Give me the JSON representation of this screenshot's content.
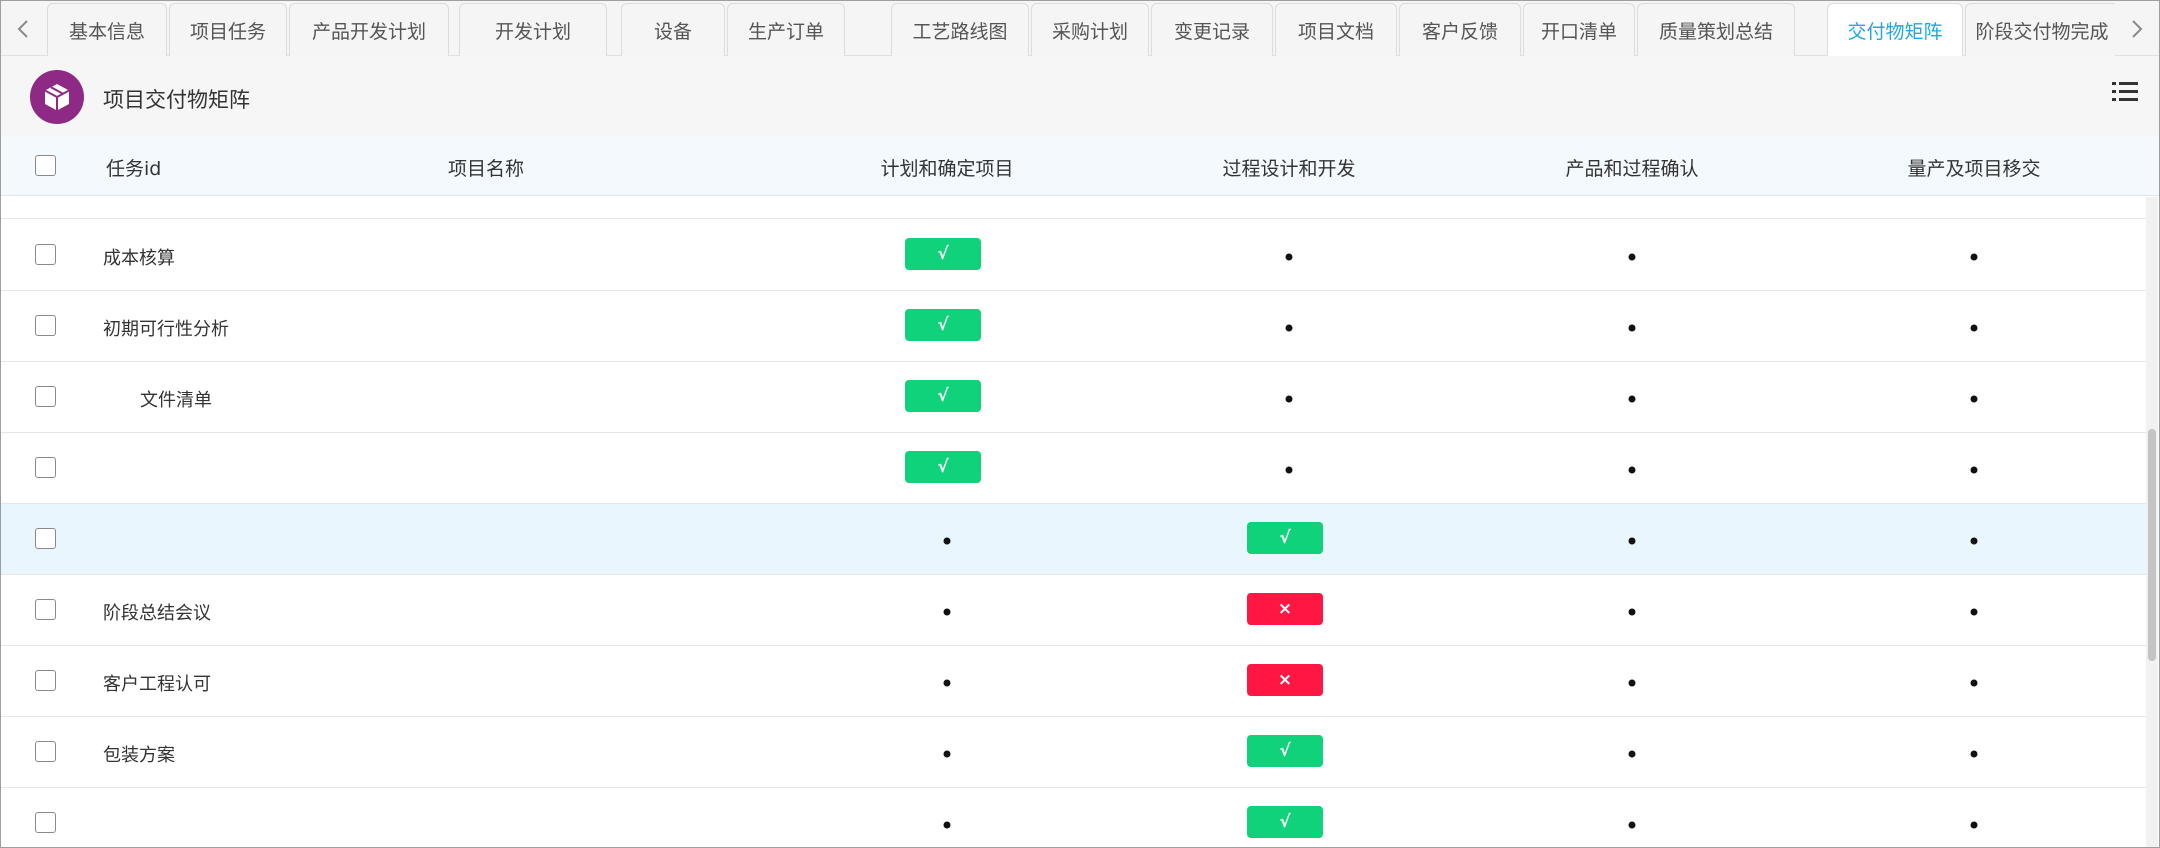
{
  "tabs": [
    {
      "label": "基本信息",
      "active": false
    },
    {
      "label": "项目任务",
      "active": false
    },
    {
      "label": "产品开发计划",
      "active": false
    },
    {
      "label": "开发计划",
      "active": false
    },
    {
      "label": "设备",
      "active": false
    },
    {
      "label": "生产订单",
      "active": false
    },
    {
      "label": "工艺路线图",
      "active": false
    },
    {
      "label": "采购计划",
      "active": false
    },
    {
      "label": "变更记录",
      "active": false
    },
    {
      "label": "项目文档",
      "active": false
    },
    {
      "label": "客户反馈",
      "active": false
    },
    {
      "label": "开口清单",
      "active": false
    },
    {
      "label": "质量策划总结",
      "active": false
    },
    {
      "label": "交付物矩阵",
      "active": true
    },
    {
      "label": "阶段交付物完成",
      "active": false
    }
  ],
  "header": {
    "title": "项目交付物矩阵"
  },
  "table": {
    "columns": {
      "task_id": "任务id",
      "project_name": "项目名称",
      "phase1": "计划和确定项目",
      "phase2": "过程设计和开发",
      "phase3": "产品和过程确认",
      "phase4": "量产及项目移交"
    },
    "rows": [
      {
        "name": "成本核算",
        "indent": false,
        "highlight": false,
        "cells": [
          "ok",
          "dot",
          "dot",
          "dot"
        ]
      },
      {
        "name": "初期可行性分析",
        "indent": false,
        "highlight": false,
        "cells": [
          "ok",
          "dot",
          "dot",
          "dot"
        ]
      },
      {
        "name": "文件清单",
        "indent": true,
        "highlight": false,
        "cells": [
          "ok",
          "dot",
          "dot",
          "dot"
        ]
      },
      {
        "name": "",
        "indent": false,
        "highlight": false,
        "cells": [
          "ok",
          "dot",
          "dot",
          "dot"
        ]
      },
      {
        "name": "",
        "indent": false,
        "highlight": true,
        "cells": [
          "dot",
          "ok",
          "dot",
          "dot"
        ]
      },
      {
        "name": "阶段总结会议",
        "indent": false,
        "highlight": false,
        "cells": [
          "dot",
          "no",
          "dot",
          "dot"
        ]
      },
      {
        "name": "客户工程认可",
        "indent": false,
        "highlight": false,
        "cells": [
          "dot",
          "no",
          "dot",
          "dot"
        ]
      },
      {
        "name": "包装方案",
        "indent": false,
        "highlight": false,
        "cells": [
          "dot",
          "ok",
          "dot",
          "dot"
        ]
      },
      {
        "name": "",
        "indent": false,
        "highlight": false,
        "cells": [
          "dot",
          "ok",
          "dot",
          "dot"
        ]
      }
    ],
    "symbols": {
      "ok": "√",
      "no": "×"
    }
  },
  "colors": {
    "ok": "#10d27a",
    "no": "#ff1744",
    "active_tab": "#1ea7e1",
    "logo": "#8e2a86"
  }
}
